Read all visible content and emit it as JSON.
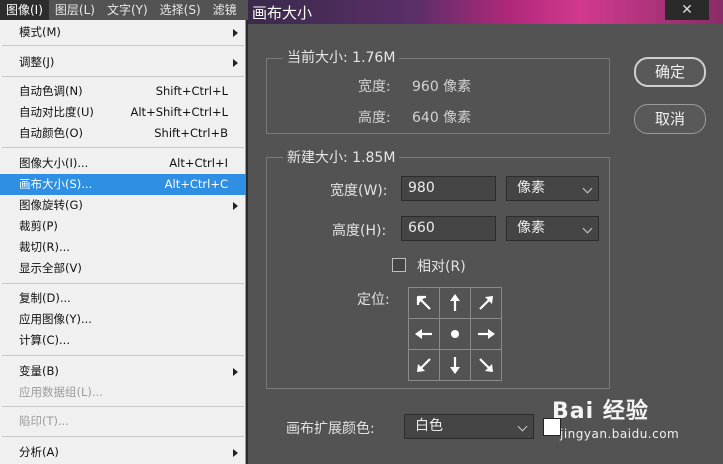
{
  "menubar": {
    "items": [
      "图像(I)",
      "图层(L)",
      "文字(Y)",
      "选择(S)",
      "滤镜"
    ]
  },
  "image_menu": {
    "items": [
      {
        "label": "模式(M)",
        "shortcut": "",
        "submenu": true
      },
      {
        "label": "调整(J)",
        "shortcut": "",
        "submenu": true
      },
      {
        "label": "自动色调(N)",
        "shortcut": "Shift+Ctrl+L"
      },
      {
        "label": "自动对比度(U)",
        "shortcut": "Alt+Shift+Ctrl+L"
      },
      {
        "label": "自动颜色(O)",
        "shortcut": "Shift+Ctrl+B"
      },
      {
        "label": "图像大小(I)...",
        "shortcut": "Alt+Ctrl+I"
      },
      {
        "label": "画布大小(S)...",
        "shortcut": "Alt+Ctrl+C"
      },
      {
        "label": "图像旋转(G)",
        "shortcut": "",
        "submenu": true
      },
      {
        "label": "裁剪(P)",
        "shortcut": ""
      },
      {
        "label": "裁切(R)...",
        "shortcut": ""
      },
      {
        "label": "显示全部(V)",
        "shortcut": ""
      },
      {
        "label": "复制(D)...",
        "shortcut": ""
      },
      {
        "label": "应用图像(Y)...",
        "shortcut": ""
      },
      {
        "label": "计算(C)...",
        "shortcut": ""
      },
      {
        "label": "变量(B)",
        "shortcut": "",
        "submenu": true
      },
      {
        "label": "应用数据组(L)...",
        "shortcut": "",
        "disabled": true
      },
      {
        "label": "陷印(T)...",
        "shortcut": "",
        "disabled": true
      },
      {
        "label": "分析(A)",
        "shortcut": "",
        "submenu": true
      }
    ]
  },
  "dialog": {
    "title": "画布大小",
    "close_glyph": "✕",
    "current_size": {
      "title": "当前大小: 1.76M",
      "width_label": "宽度:",
      "width_value": "960 像素",
      "height_label": "高度:",
      "height_value": "640 像素"
    },
    "new_size": {
      "title": "新建大小: 1.85M",
      "width_label": "宽度(W):",
      "width_value": "980",
      "width_unit": "像素",
      "height_label": "高度(H):",
      "height_value": "660",
      "height_unit": "像素",
      "relative_label": "相对(R)",
      "relative_checked": false,
      "anchor_label": "定位:"
    },
    "extension_color_label": "画布扩展颜色:",
    "extension_color_value": "白色",
    "extension_color_swatch": "#ffffff",
    "ok_label": "确定",
    "cancel_label": "取消"
  },
  "watermark": {
    "logo_text": "Bai 经验",
    "url": "jingyan.baidu.com"
  },
  "colors": {
    "menu_highlight": "#2f8fe3",
    "dialog_bg": "#535353",
    "menu_bg": "#f0f0f0"
  }
}
